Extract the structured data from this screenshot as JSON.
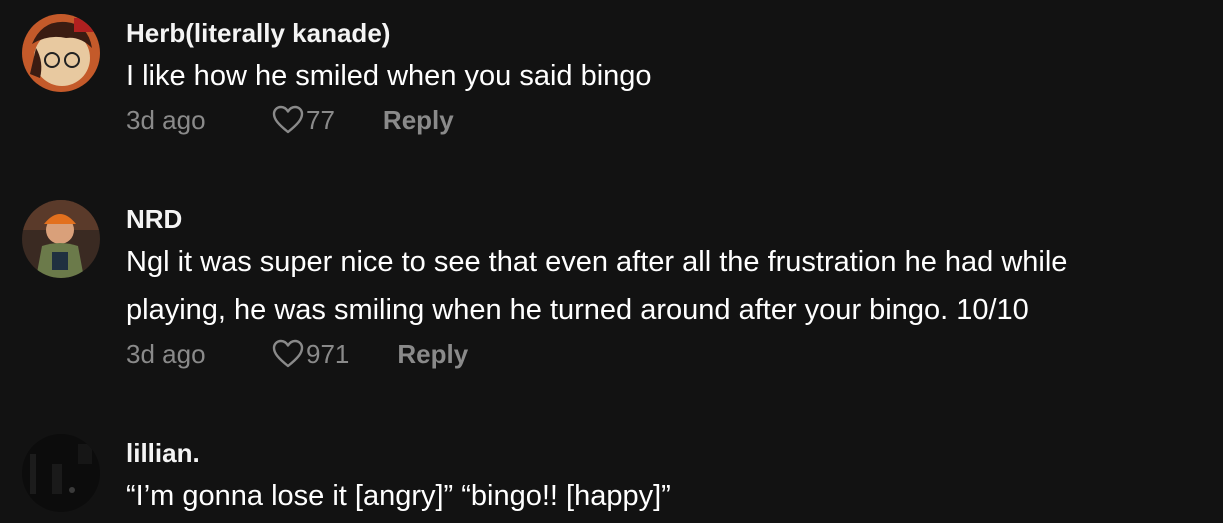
{
  "comments": [
    {
      "username": "Herb(literally kanade)",
      "lines": [
        "I like how he smiled when you said bingo"
      ],
      "time": "3d ago",
      "likes": "77",
      "reply_label": "Reply"
    },
    {
      "username": "NRD",
      "lines": [
        "Ngl it was super nice to see that even after all the frustration he had while",
        "playing, he was smiling when he turned around after your bingo. 10/10"
      ],
      "time": "3d ago",
      "likes": "971",
      "reply_label": "Reply"
    },
    {
      "username": "lillian.",
      "lines": [
        "“I’m gonna lose it [angry]” “bingo!! [happy]”"
      ]
    }
  ],
  "icons": {
    "like": "heart-outline-icon"
  },
  "colors": {
    "background": "#121212",
    "secondary_text": "#8a8a8a"
  }
}
